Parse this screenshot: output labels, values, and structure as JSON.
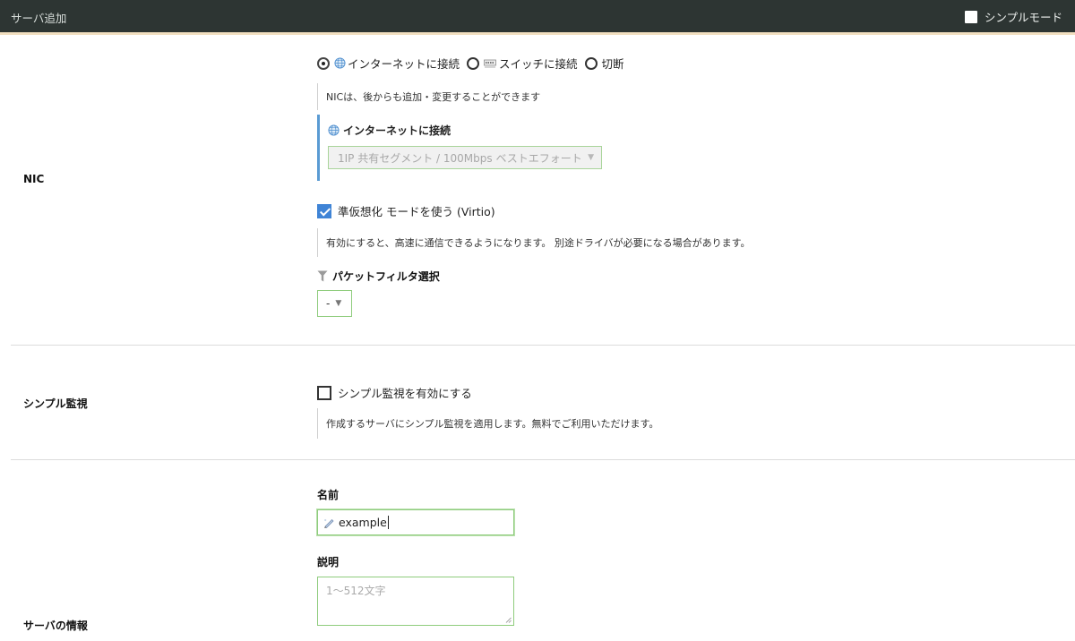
{
  "header": {
    "title": "サーバ追加",
    "simple_mode_label": "シンプルモード",
    "simple_mode_checked": false
  },
  "nic": {
    "section_label": "NIC",
    "options": [
      {
        "label": "インターネットに接続",
        "selected": true,
        "icon": "globe-icon"
      },
      {
        "label": "スイッチに接続",
        "selected": false,
        "icon": "switch-icon"
      },
      {
        "label": "切断",
        "selected": false
      }
    ],
    "note": "NICは、後からも追加・変更することができます",
    "internet_heading": "インターネットに接続",
    "segment_value": "1IP 共有セグメント / 100Mbps ベストエフォート",
    "virtio_label": "準仮想化 モードを使う (Virtio)",
    "virtio_checked": true,
    "virtio_note": "有効にすると、高速に通信できるようになります。 別途ドライバが必要になる場合があります。",
    "packet_filter_label": "パケットフィルタ選択",
    "packet_filter_value": "-"
  },
  "monitor": {
    "section_label": "シンプル監視",
    "checkbox_label": "シンプル監視を有効にする",
    "checked": false,
    "note": "作成するサーバにシンプル監視を適用します。無料でご利用いただけます。"
  },
  "server_info": {
    "section_label": "サーバの情報",
    "name_label": "名前",
    "name_value": "example",
    "desc_label": "説明",
    "desc_placeholder": "1〜512文字"
  },
  "colors": {
    "header_bg": "#2d3533",
    "accent_blue": "#3f84d6",
    "input_border_green": "#8fcc7d",
    "internet_bar": "#5a9bd3"
  }
}
